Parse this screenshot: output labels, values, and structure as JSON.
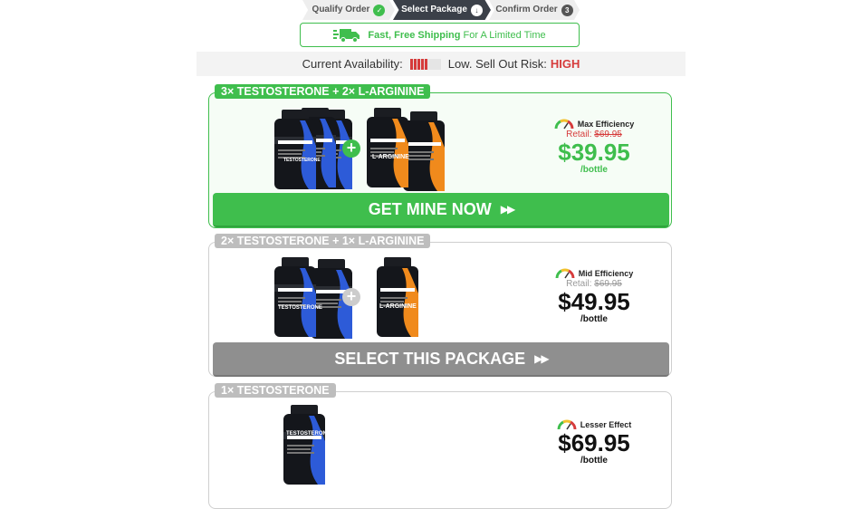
{
  "steps": [
    {
      "label": "Qualify Order",
      "badge": "✓"
    },
    {
      "label": "Select Package",
      "badge": "↓"
    },
    {
      "label": "Confirm Order",
      "badge": "3"
    }
  ],
  "shipping": {
    "bold": "Fast, Free Shipping",
    "rest": "For A Limited Time"
  },
  "availability": {
    "label": "Current Availability:",
    "risk_label": "Low. Sell Out Risk:",
    "risk_value": "HIGH"
  },
  "bottle_labels": {
    "testosterone": "TESTOSTERONE",
    "arginine": "L-ARGININE"
  },
  "packages": [
    {
      "tag": "3× TESTOSTERONE + 2× L-ARGININE",
      "efficiency": "Max Efficiency",
      "retail_label": "Retail:",
      "retail_price": "$69.95",
      "price": "$39.95",
      "per": "/bottle",
      "cta": "GET MINE NOW",
      "cta_icon": "▶▶"
    },
    {
      "tag": "2× TESTOSTERONE + 1× L-ARGININE",
      "efficiency": "Mid Efficiency",
      "retail_label": "Retail:",
      "retail_price": "$69.95",
      "price": "$49.95",
      "per": "/bottle",
      "cta": "SELECT THIS PACKAGE",
      "cta_icon": "▶▶"
    },
    {
      "tag": "1× TESTOSTERONE",
      "efficiency": "Lesser Effect",
      "price": "$69.95",
      "per": "/bottle"
    }
  ],
  "colors": {
    "accent": "#3fbe4d",
    "risk": "#d63b3b",
    "dark": "#3b4049",
    "gray_cta": "#8f8f8f"
  },
  "icons": [
    "check-icon",
    "download-arrow-icon",
    "truck-icon",
    "gauge-icon",
    "plus-icon",
    "double-arrow-icon"
  ]
}
